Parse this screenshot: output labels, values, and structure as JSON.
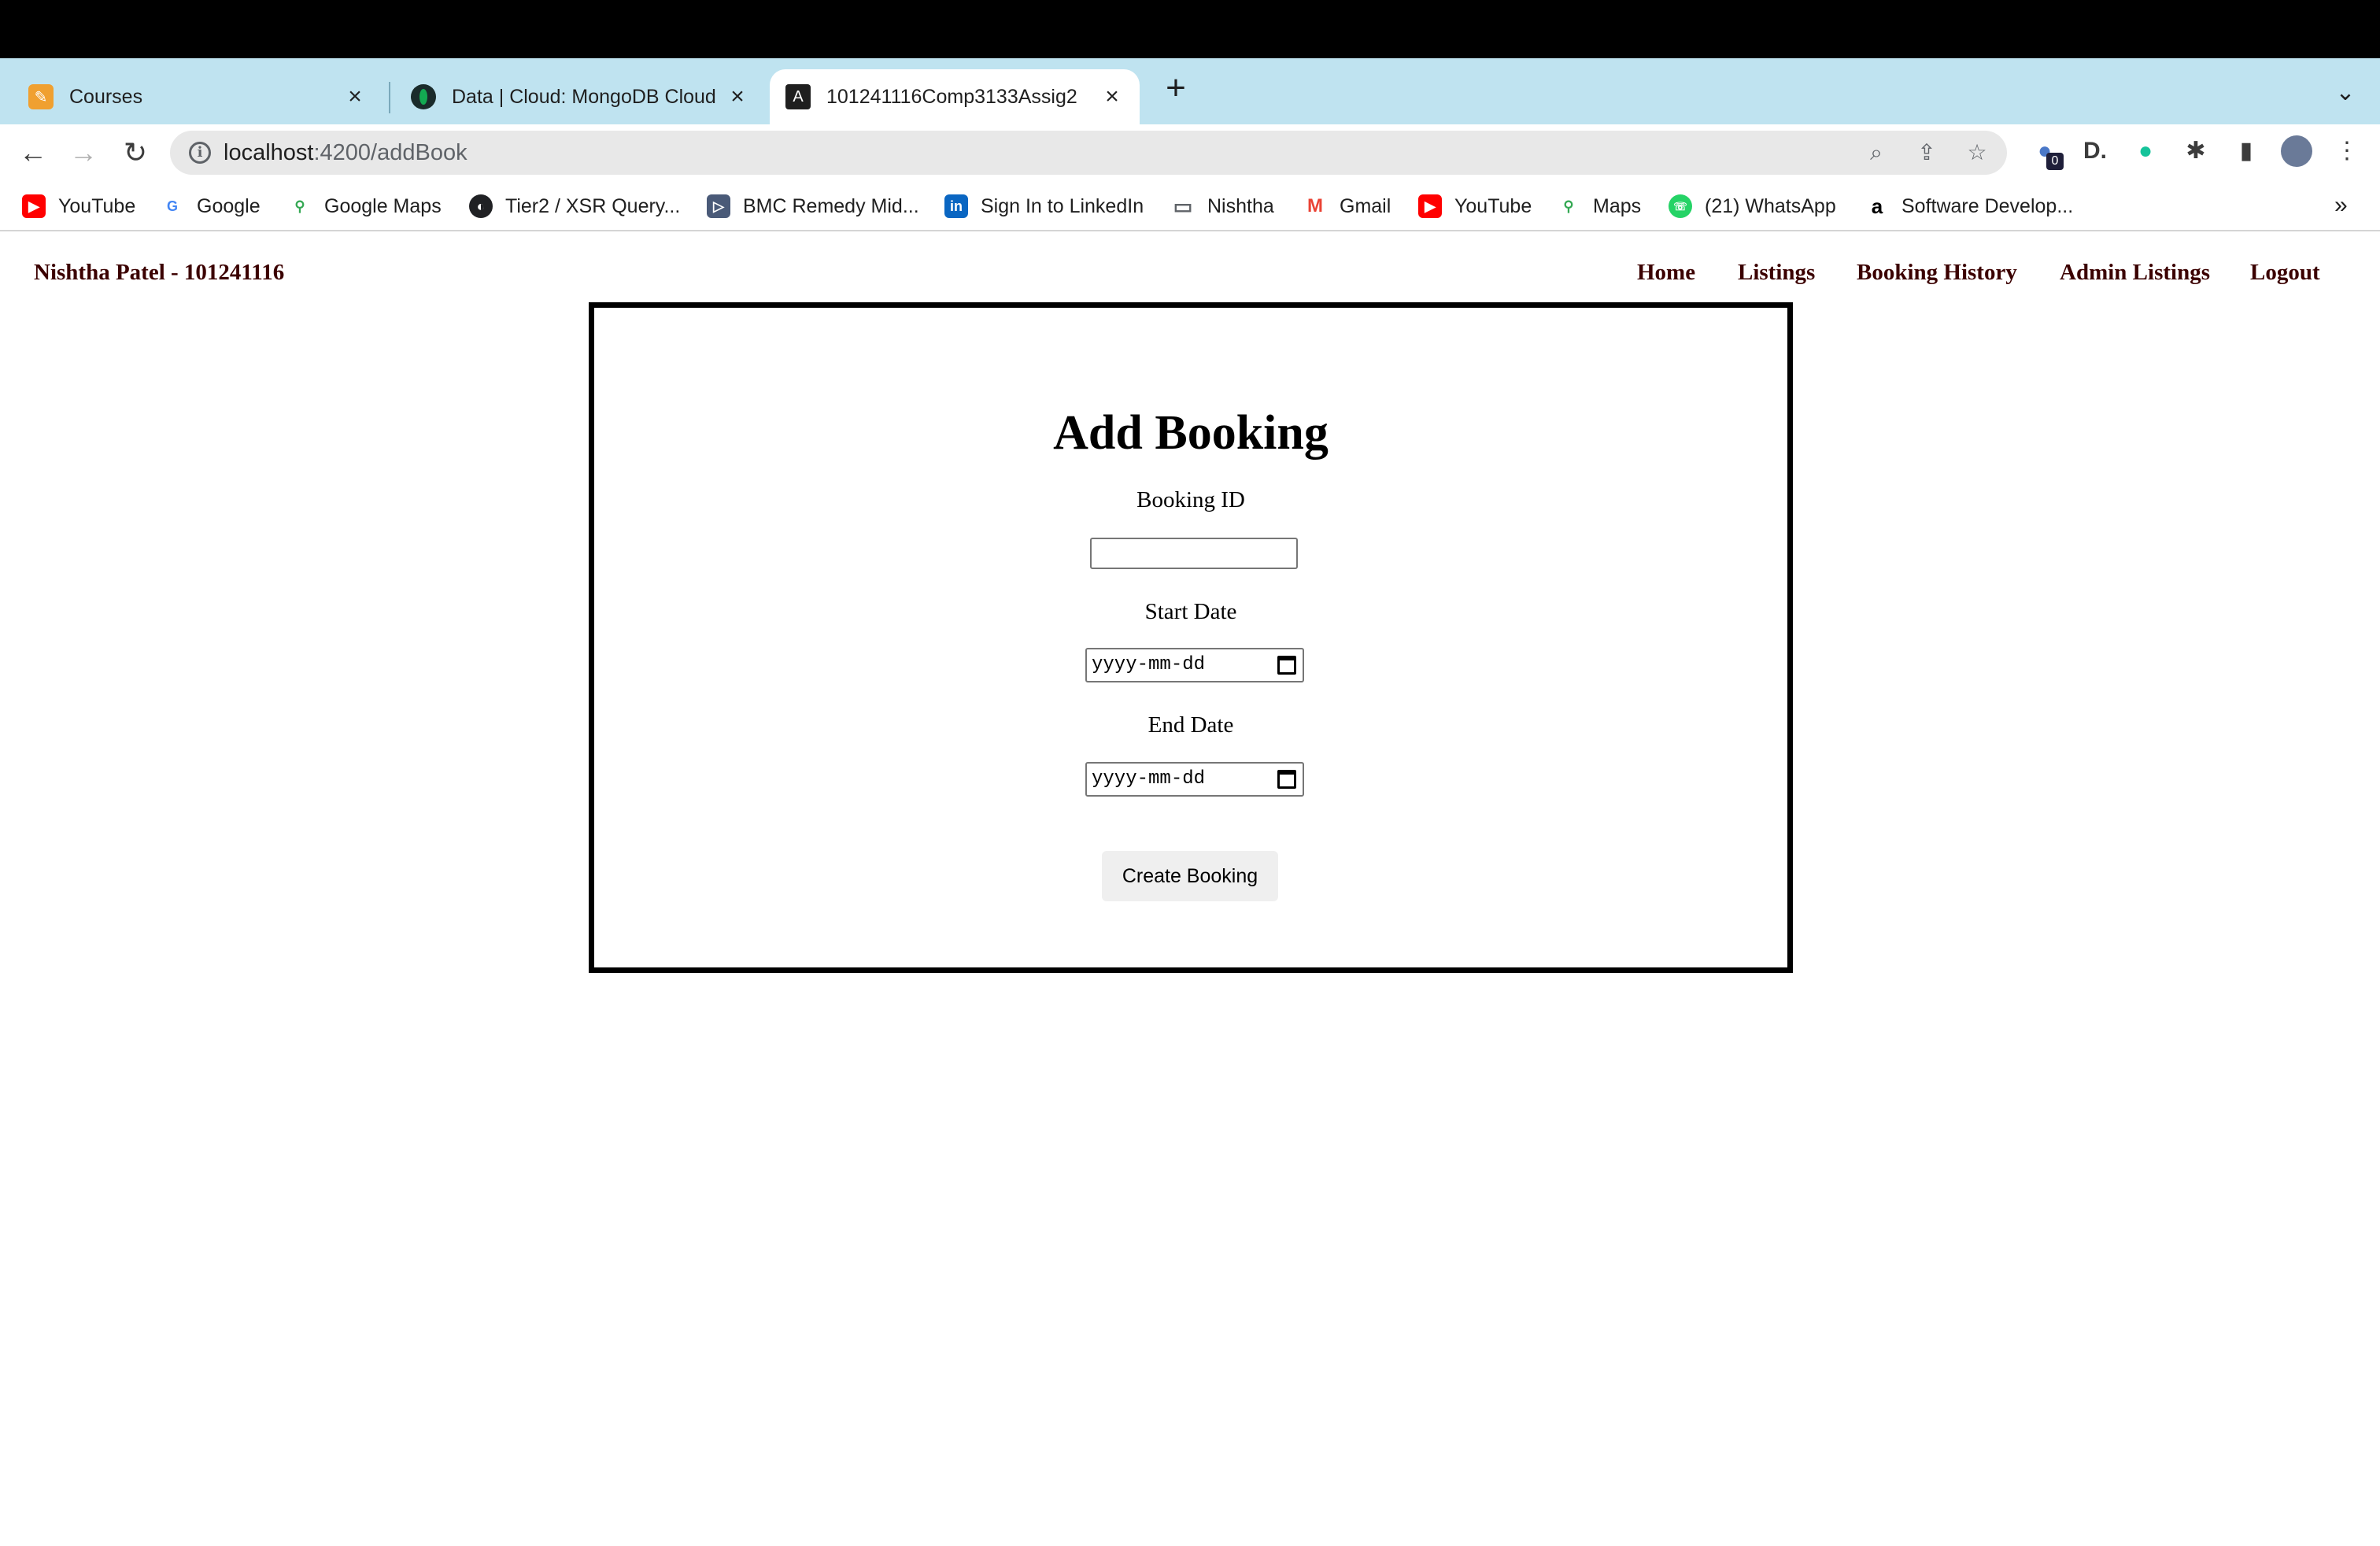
{
  "browser": {
    "tabs": [
      {
        "title": "Courses",
        "active": false
      },
      {
        "title": "Data | Cloud: MongoDB Cloud",
        "active": false
      },
      {
        "title": "101241116Comp3133Assig2",
        "active": true
      }
    ],
    "new_tab_symbol": "+",
    "url_host": "localhost",
    "url_path": ":4200/addBook",
    "extension_badge": "0",
    "bookmarks": [
      {
        "label": "YouTube",
        "icon": "youtube-icon",
        "color": "#ff0000"
      },
      {
        "label": "Google",
        "icon": "google-icon",
        "color": "#4285f4"
      },
      {
        "label": "Google Maps",
        "icon": "maps-pin-icon",
        "color": "#34a853"
      },
      {
        "label": "Tier2 / XSR Query...",
        "icon": "globe-icon",
        "color": "#202124"
      },
      {
        "label": "BMC Remedy Mid...",
        "icon": "bmc-icon",
        "color": "#4a5a78"
      },
      {
        "label": "Sign In to LinkedIn",
        "icon": "linkedin-icon",
        "color": "#0a66c2"
      },
      {
        "label": "Nishtha",
        "icon": "folder-icon",
        "color": "#5f6368"
      },
      {
        "label": "Gmail",
        "icon": "gmail-icon",
        "color": "#ea4335"
      },
      {
        "label": "YouTube",
        "icon": "youtube-icon",
        "color": "#ff0000"
      },
      {
        "label": "Maps",
        "icon": "maps-pin-icon",
        "color": "#34a853"
      },
      {
        "label": "(21) WhatsApp",
        "icon": "whatsapp-icon",
        "color": "#25d366"
      },
      {
        "label": "Software Develop...",
        "icon": "amazon-icon",
        "color": "#000000"
      }
    ],
    "bookmarks_overflow": "»"
  },
  "page": {
    "site_name": "Nishtha Patel - 101241116",
    "nav": [
      "Home",
      "Listings",
      "Booking History",
      "Admin Listings",
      "Logout"
    ],
    "form": {
      "title": "Add Booking",
      "booking_id_label": "Booking ID",
      "booking_id_value": "",
      "start_date_label": "Start Date",
      "start_date_placeholder": "yyyy-mm-dd",
      "end_date_label": "End Date",
      "end_date_placeholder": "yyyy-mm-dd",
      "submit_label": "Create Booking"
    }
  },
  "colors": {
    "tabstrip": "#bfe3f0",
    "nav_text": "#3b0000",
    "form_border": "#000000"
  }
}
